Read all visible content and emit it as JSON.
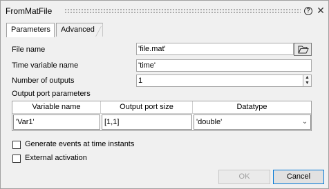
{
  "window": {
    "title": "FromMatFile"
  },
  "tabs": [
    {
      "label": "Parameters",
      "active": true
    },
    {
      "label": "Advanced",
      "active": false
    }
  ],
  "fields": {
    "file_name": {
      "label": "File name",
      "value": "'file.mat'"
    },
    "time_variable": {
      "label": "Time variable name",
      "value": "'time'"
    },
    "num_outputs": {
      "label": "Number of outputs",
      "value": "1"
    }
  },
  "output_params": {
    "section_label": "Output port parameters",
    "columns": [
      "Variable name",
      "Output port size",
      "Datatype"
    ],
    "rows": [
      {
        "variable_name": "'Var1'",
        "port_size": "[1,1]",
        "datatype": "'double'"
      }
    ]
  },
  "options": {
    "generate_events": {
      "label": "Generate events at time instants",
      "checked": false
    },
    "external_activation": {
      "label": "External activation",
      "checked": false
    }
  },
  "buttons": {
    "ok": "OK",
    "cancel": "Cancel"
  },
  "icons": {
    "help": "help-icon",
    "close": "close-icon",
    "browse": "folder-open-icon",
    "dropdown": "chevron-down-icon"
  }
}
